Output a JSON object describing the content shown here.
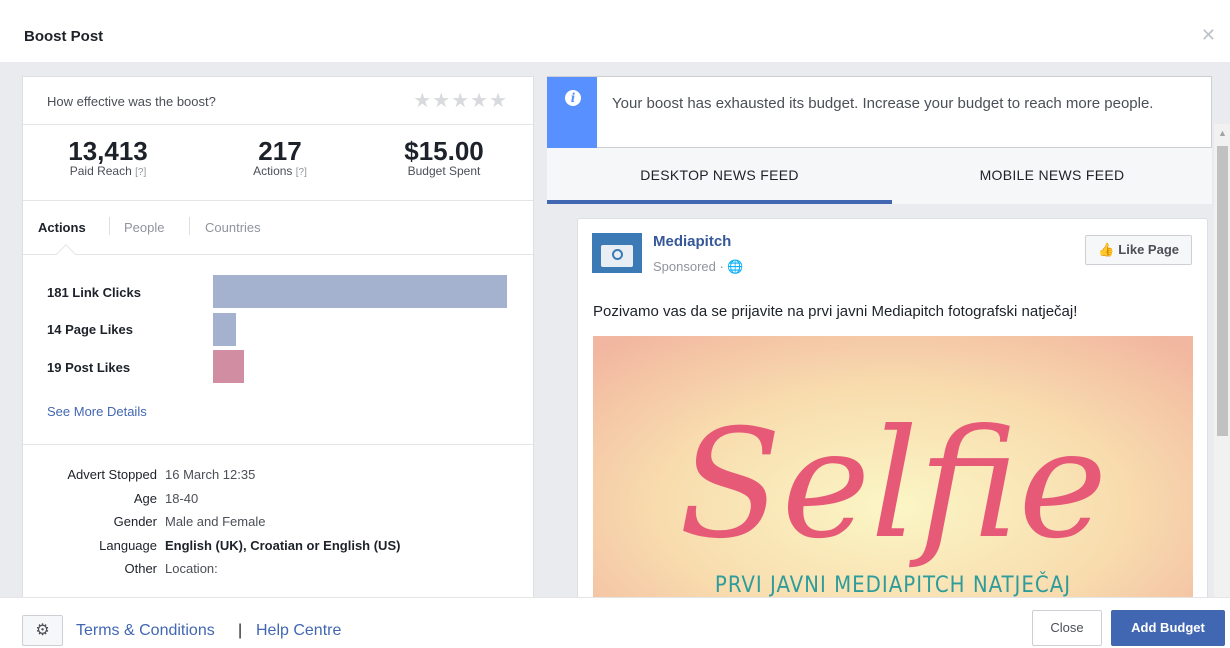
{
  "header": {
    "title": "Boost Post",
    "close_icon": "close-icon"
  },
  "rating": {
    "question": "How effective was the boost?",
    "stars": "★★★★★"
  },
  "stats": [
    {
      "value": "13,413",
      "label": "Paid Reach",
      "help": "[?]"
    },
    {
      "value": "217",
      "label": "Actions",
      "help": "[?]"
    },
    {
      "value": "$15.00",
      "label": "Budget Spent",
      "help": ""
    }
  ],
  "tabs": [
    {
      "label": "Actions",
      "active": true
    },
    {
      "label": "People",
      "active": false
    },
    {
      "label": "Countries",
      "active": false
    }
  ],
  "actions": [
    {
      "label": "181 Link Clicks",
      "count": 181,
      "color": "#a4b1cf"
    },
    {
      "label": "14 Page Likes",
      "count": 14,
      "color": "#a4b1cf"
    },
    {
      "label": "19 Post Likes",
      "count": 19,
      "color": "#d18ea3"
    }
  ],
  "see_more": "See More Details",
  "details": [
    {
      "key": "Advert Stopped",
      "value": "16 March 12:35",
      "bold": false
    },
    {
      "key": "Age",
      "value": "18-40",
      "bold": false
    },
    {
      "key": "Gender",
      "value": "Male and Female",
      "bold": false
    },
    {
      "key": "Language",
      "value": "English (UK), Croatian or English (US)",
      "bold": true
    },
    {
      "key": "Other",
      "value": "Location:",
      "bold": false
    }
  ],
  "notice": {
    "icon": "i",
    "text": "Your boost has exhausted its budget. Increase your budget to reach more people."
  },
  "feed_tabs": [
    {
      "label": "DESKTOP NEWS FEED",
      "active": true
    },
    {
      "label": "MOBILE NEWS FEED",
      "active": false
    }
  ],
  "post": {
    "page_name": "Mediapitch",
    "sponsored": "Sponsored · 🌐",
    "like_button": "Like Page",
    "text": "Pozivamo vas da se prijavite na prvi javni Mediapitch fotografski natječaj!",
    "image_title": "Selfie",
    "image_subtitle": "PRVI JAVNI MEDIAPITCH NATJEČAJ"
  },
  "footer": {
    "terms": "Terms & Conditions",
    "separator": "|",
    "help": "Help Centre",
    "close": "Close",
    "add_budget": "Add Budget"
  },
  "colors": {
    "accent": "#4267b2",
    "notice": "#5890ff",
    "selfie": "#e65a78"
  }
}
